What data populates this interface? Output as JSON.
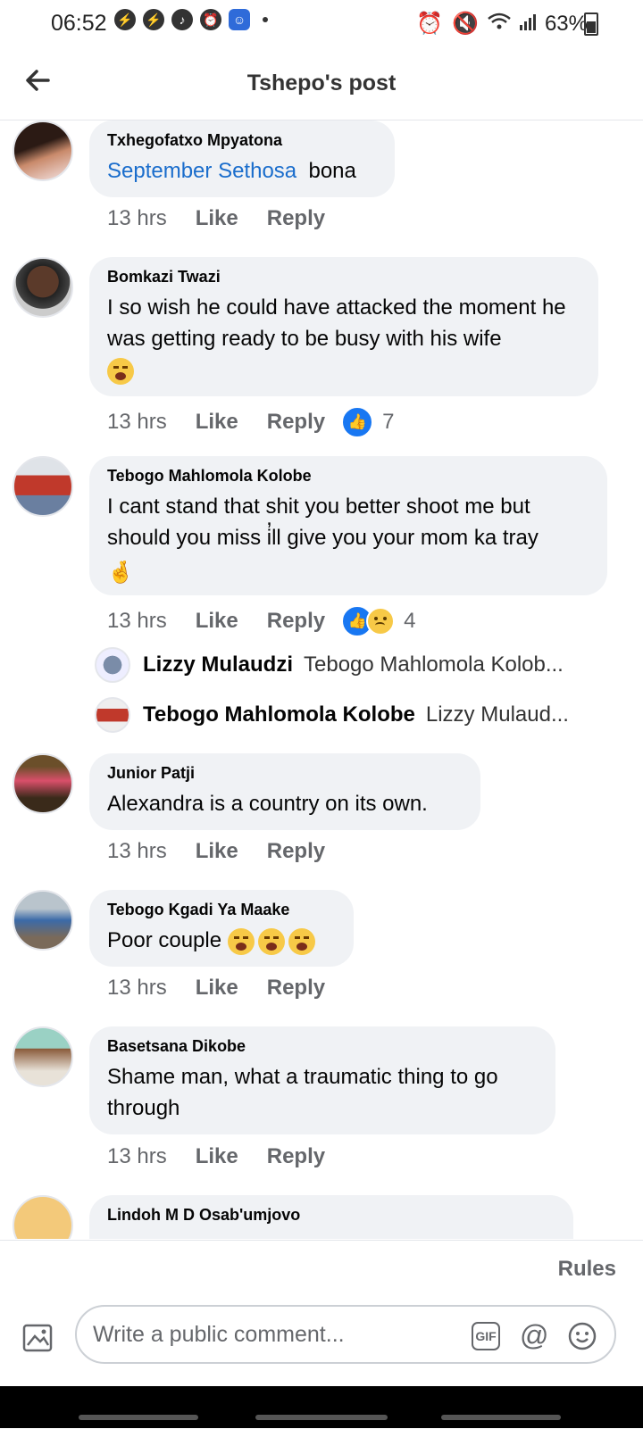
{
  "status_bar": {
    "time": "06:52",
    "battery": "63%"
  },
  "header": {
    "title": "Tshepo's post"
  },
  "comments": [
    {
      "author": "Txhegofatxo Mpyatona",
      "mention": "September Sethosa",
      "text": "bona",
      "time": "13 hrs",
      "like": "Like",
      "reply": "Reply"
    },
    {
      "author": "Bomkazi Twazi",
      "text": "I so wish he could have attacked the moment he was getting ready to be busy with his wife",
      "time": "13 hrs",
      "like": "Like",
      "reply": "Reply",
      "reaction_count": "7"
    },
    {
      "author": "Tebogo Mahlomola Kolobe",
      "text": "I cant stand that shit you better shoot me but should you miss i̓ll give you your mom ka tray",
      "time": "13 hrs",
      "like": "Like",
      "reply": "Reply",
      "reaction_count": "4",
      "replies": [
        {
          "author": "Lizzy Mulaudzi",
          "text": "Tebogo Mahlomola Kolob..."
        },
        {
          "author": "Tebogo Mahlomola Kolobe",
          "text": "Lizzy Mulaud..."
        }
      ]
    },
    {
      "author": "Junior Patji",
      "text": "Alexandra is a country on its own.",
      "time": "13 hrs",
      "like": "Like",
      "reply": "Reply"
    },
    {
      "author": "Tebogo Kgadi Ya Maake",
      "text": "Poor couple",
      "time": "13 hrs",
      "like": "Like",
      "reply": "Reply"
    },
    {
      "author": "Basetsana Dikobe",
      "text": "Shame man, what a traumatic thing to go through",
      "time": "13 hrs",
      "like": "Like",
      "reply": "Reply"
    },
    {
      "author": "Lindoh M D Osab'umjovo"
    }
  ],
  "footer": {
    "rules": "Rules",
    "placeholder": "Write a public comment...",
    "gif": "GIF",
    "at": "@"
  },
  "colors": {
    "accent": "#1877f2",
    "bubble": "#f0f2f5",
    "mention": "#1a6dcc"
  }
}
